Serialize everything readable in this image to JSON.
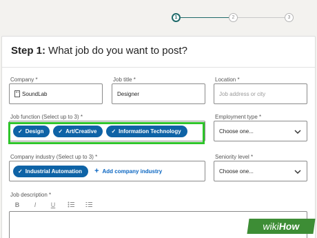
{
  "stepper": {
    "steps": [
      "1",
      "2",
      "3"
    ],
    "active": 0
  },
  "header": {
    "step_prefix": "Step 1:",
    "question": " What job do you want to post?"
  },
  "company": {
    "label": "Company *",
    "value": "SoundLab"
  },
  "job_title": {
    "label": "Job title *",
    "value": "Designer"
  },
  "location": {
    "label": "Location *",
    "placeholder": "Job address or city"
  },
  "job_function": {
    "label": "Job function (Select up to 3) *",
    "tags": [
      "Design",
      "Art/Creative",
      "Information Technology"
    ]
  },
  "employment_type": {
    "label": "Employment type *",
    "value": "Choose one..."
  },
  "industry": {
    "label": "Company industry (Select up to 3) *",
    "tags": [
      "Industrial Automation"
    ],
    "add_label": "Add company industry"
  },
  "seniority": {
    "label": "Seniority level *",
    "value": "Choose one..."
  },
  "description": {
    "label": "Job description *",
    "toolbar": [
      "B",
      "I",
      "U",
      "list-bullet-icon",
      "list-numbered-icon"
    ]
  },
  "watermark": {
    "prefix": "wiki",
    "suffix": "How"
  },
  "colors": {
    "accent": "#0e63a6",
    "highlight": "#2ec42a",
    "stepper_active": "#1f6a6a"
  }
}
